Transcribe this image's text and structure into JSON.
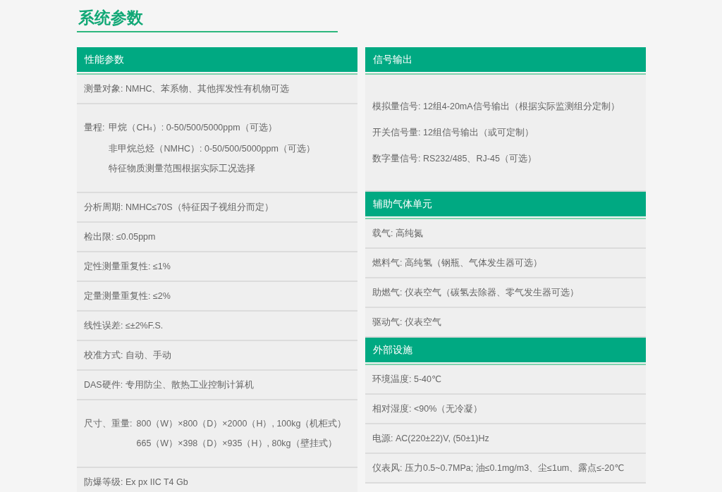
{
  "title": "系统参数",
  "columns": [
    {
      "sections": [
        {
          "heading": "性能参数",
          "rows": [
            {
              "text": "测量对象: NMHC、苯系物、其他挥发性有机物可选"
            },
            {
              "label": "量程:",
              "lines": [
                "甲烷（CH$_{4}$）: 0-50/500/5000ppm（可选）",
                "非甲烷总烃（NMHC）: 0-50/500/5000ppm（可选）",
                "特征物质测量范围根据实际工况选择"
              ]
            },
            {
              "text": "分析周期: NMHC≤70S（特征因子视组分而定）"
            },
            {
              "text": "检出限: ≤0.05ppm"
            },
            {
              "text": "定性测量重复性: ≤1%"
            },
            {
              "text": "定量测量重复性: ≤2%"
            },
            {
              "text": "线性误差: ≤±2%F.S."
            },
            {
              "text": "校准方式: 自动、手动"
            },
            {
              "text": "DAS硬件: 专用防尘、散热工业控制计算机"
            },
            {
              "label": "尺寸、重量:",
              "lines": [
                "800（W）×800（D）×2000（H）, 100kg（机柜式）",
                "665（W）×398（D）×935（H）, 80kg（壁挂式）"
              ]
            },
            {
              "text": "防爆等级: Ex px IIC T4 Gb"
            }
          ]
        }
      ]
    },
    {
      "sections": [
        {
          "heading": "信号输出",
          "rows": [
            {
              "lines": [
                "模拟量信号: 12组4-20mA信号输出（根据实际监测组分定制）",
                "开关信号量: 12组信号输出（或可定制）",
                "数字量信号: RS232/485、RJ-45（可选）"
              ]
            }
          ]
        },
        {
          "heading": "辅助气体单元",
          "rows": [
            {
              "text": "载气: 高纯氮"
            },
            {
              "text": "燃料气: 高纯氢（钢瓶、气体发生器可选）"
            },
            {
              "text": "助燃气: 仪表空气（碳氢去除器、零气发生器可选）"
            },
            {
              "text": "驱动气: 仪表空气"
            }
          ]
        },
        {
          "heading": "外部设施",
          "rows": [
            {
              "text": "环境温度: 5-40℃"
            },
            {
              "text": "相对湿度: <90%（无冷凝）"
            },
            {
              "text": "电源: AC(220±22)V, (50±1)Hz"
            },
            {
              "text": "仪表风: 压力0.5~0.7MPa; 油≤0.1mg/m3、尘≤1um、露点≤-20℃"
            }
          ]
        }
      ]
    }
  ]
}
